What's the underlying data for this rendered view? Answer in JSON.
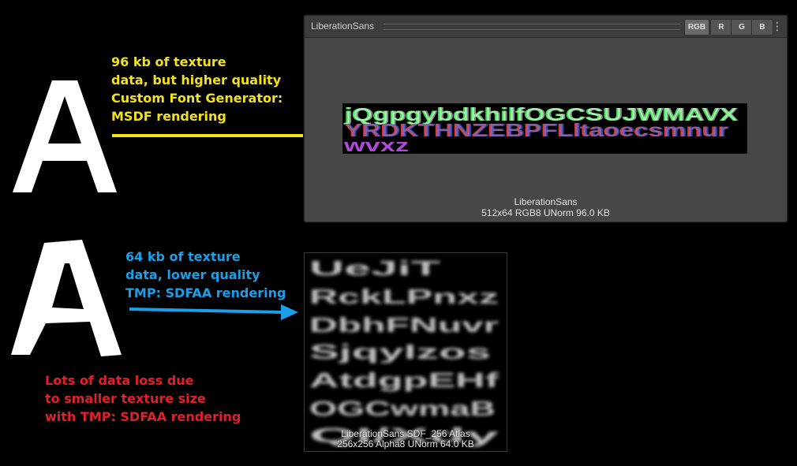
{
  "annotations": {
    "msdf": {
      "lines": [
        "96 kb of texture",
        "data, but higher quality",
        "Custom Font Generator:",
        "MSDF rendering"
      ],
      "color": "#f4e21a"
    },
    "sdf": {
      "lines": [
        "64 kb of texture",
        "data, lower quality",
        "TMP: SDFAA rendering"
      ],
      "color": "#1aa0e8"
    },
    "loss": {
      "lines": [
        "Lots of data loss due",
        "to smaller texture size",
        "with TMP: SDFAA rendering"
      ],
      "color": "#e2202a"
    }
  },
  "preview_panel": {
    "title": "LiberationSans",
    "channels": [
      "RGB",
      "R",
      "G",
      "B"
    ],
    "active_channel": "RGB",
    "more_icon": "more-vertical-icon",
    "texture_name": "LiberationSans",
    "texture_info": "512x64  RGB8 UNorm   96.0 KB",
    "atlas_rows": [
      "jQgpgybdkhilfOGCSUJWMAVX",
      "YRDKTHNZEBPFLltaoecsmnur",
      "wvxz"
    ]
  },
  "sdf_atlas": {
    "texture_name": "LiberationSans SDF_256 Atlas",
    "texture_info": "256x256  Alpha8 UNorm   64.0 KB",
    "glyph_rows": [
      "UeJiT",
      "RckLPnxz",
      "DbhFNuvr",
      "SjqyIzos",
      "AtdgpEHf",
      "OGCwmaB",
      "QI/Xdy"
    ]
  }
}
